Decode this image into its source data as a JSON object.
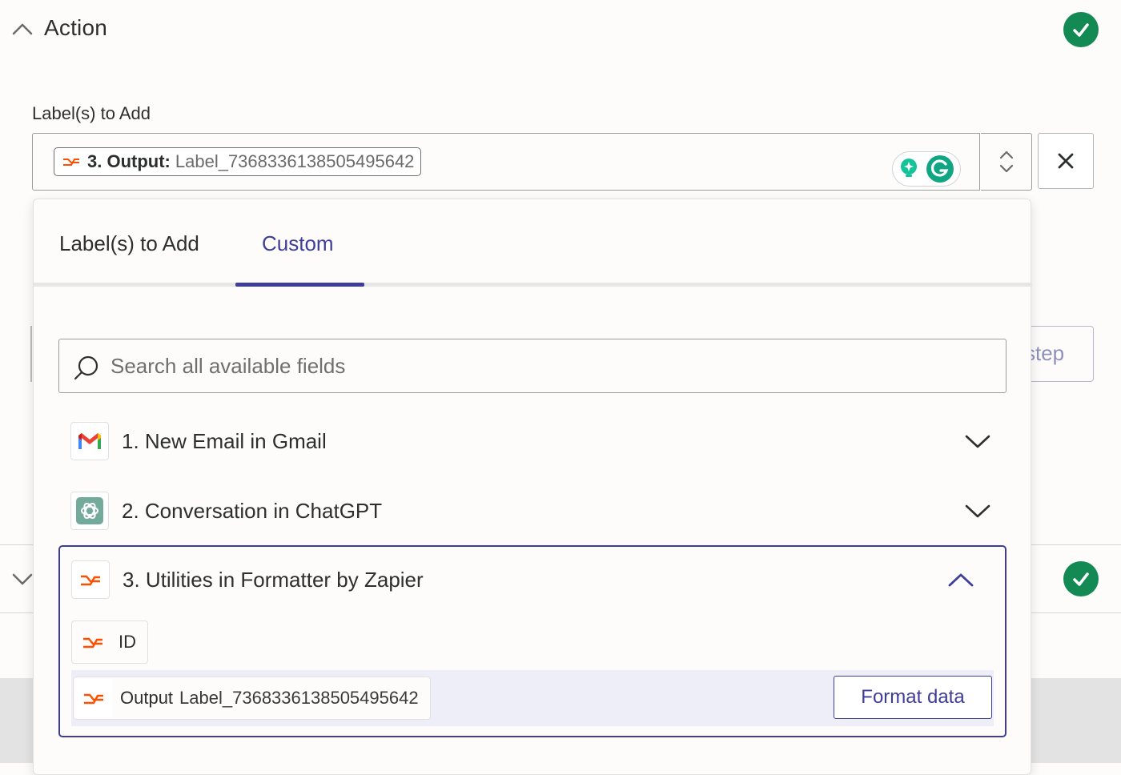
{
  "section": {
    "title": "Action"
  },
  "field": {
    "label": "Label(s) to Add",
    "token": {
      "step": "3. Output:",
      "value": "Label_7368336138505495642"
    }
  },
  "background": {
    "step_button_partial": "step"
  },
  "dropdown": {
    "tabs": [
      {
        "label": "Label(s) to Add",
        "active": false
      },
      {
        "label": "Custom",
        "active": true
      }
    ],
    "search": {
      "placeholder": "Search all available fields"
    },
    "apps": [
      {
        "title": "1. New Email in Gmail",
        "icon": "gmail-icon",
        "expanded": false
      },
      {
        "title": "2. Conversation in ChatGPT",
        "icon": "chatgpt-icon",
        "expanded": false
      },
      {
        "title": "3. Utilities in Formatter by Zapier",
        "icon": "formatter-icon",
        "expanded": true
      }
    ],
    "fields": {
      "id_label": "ID",
      "output_label": "Output",
      "output_value": "Label_7368336138505495642",
      "format_button": "Format data"
    }
  },
  "colors": {
    "accent": "#3d3d9c",
    "success": "#138953",
    "formatter": "#ff4f00",
    "grammarly": "#15c39a"
  }
}
